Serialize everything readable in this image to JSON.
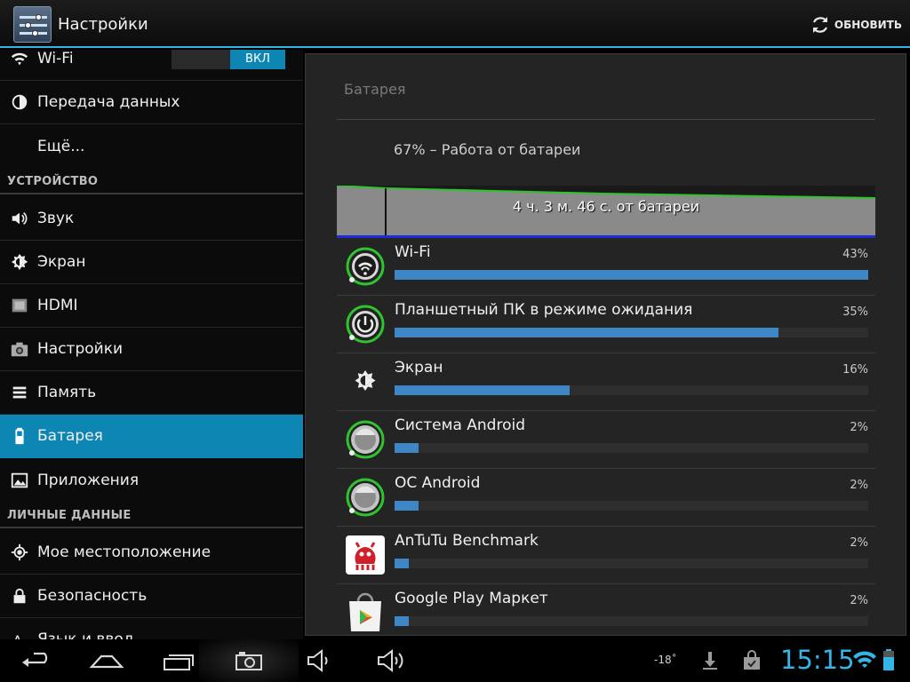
{
  "action_bar": {
    "title": "Настройки",
    "refresh_label": "ОБНОВИТЬ",
    "accent_color": "#33b5e5"
  },
  "sidebar": {
    "wifi_toggle_label": "ВКЛ",
    "items": [
      {
        "label": "Wi-Fi",
        "icon": "wifi-icon"
      },
      {
        "label": "Передача данных",
        "icon": "data-usage-icon"
      },
      {
        "label": "Ещё...",
        "icon": ""
      },
      {
        "label": "Звук",
        "icon": "speaker-icon"
      },
      {
        "label": "Экран",
        "icon": "brightness-icon"
      },
      {
        "label": "HDMI",
        "icon": "hdmi-icon"
      },
      {
        "label": "Настройки",
        "icon": "camera-icon"
      },
      {
        "label": "Память",
        "icon": "storage-icon"
      },
      {
        "label": "Батарея",
        "icon": "battery-icon",
        "selected": true
      },
      {
        "label": "Приложения",
        "icon": "apps-icon"
      },
      {
        "label": "Мое местоположение",
        "icon": "location-icon"
      },
      {
        "label": "Безопасность",
        "icon": "lock-icon"
      },
      {
        "label": "Язык и ввод",
        "icon": "language-icon"
      }
    ],
    "sections": [
      "УСТРОЙСТВО",
      "ЛИЧНЫЕ ДАННЫЕ"
    ]
  },
  "battery": {
    "title": "Батарея",
    "status": "67% – Работа от батареи",
    "graph_label": "4 ч. 3 м. 46 с. от батареи",
    "usage": [
      {
        "name": "Wi-Fi",
        "percent_label": "43%",
        "fraction": 1.0,
        "icon": "wifi-app-icon"
      },
      {
        "name": "Планшетный ПК в режиме ожидания",
        "percent_label": "35%",
        "fraction": 0.81,
        "icon": "power-icon"
      },
      {
        "name": "Экран",
        "percent_label": "16%",
        "fraction": 0.37,
        "icon": "brightness-icon"
      },
      {
        "name": "Система Android",
        "percent_label": "2%",
        "fraction": 0.05,
        "icon": "android-system-icon"
      },
      {
        "name": "ОС Android",
        "percent_label": "2%",
        "fraction": 0.05,
        "icon": "android-os-icon"
      },
      {
        "name": "AnTuTu Benchmark",
        "percent_label": "2%",
        "fraction": 0.03,
        "icon": "antutu-icon"
      },
      {
        "name": "Google Play Маркет",
        "percent_label": "2%",
        "fraction": 0.03,
        "icon": "play-store-icon"
      }
    ]
  },
  "navbar": {
    "temperature": "-18˚",
    "clock": "15:15"
  }
}
